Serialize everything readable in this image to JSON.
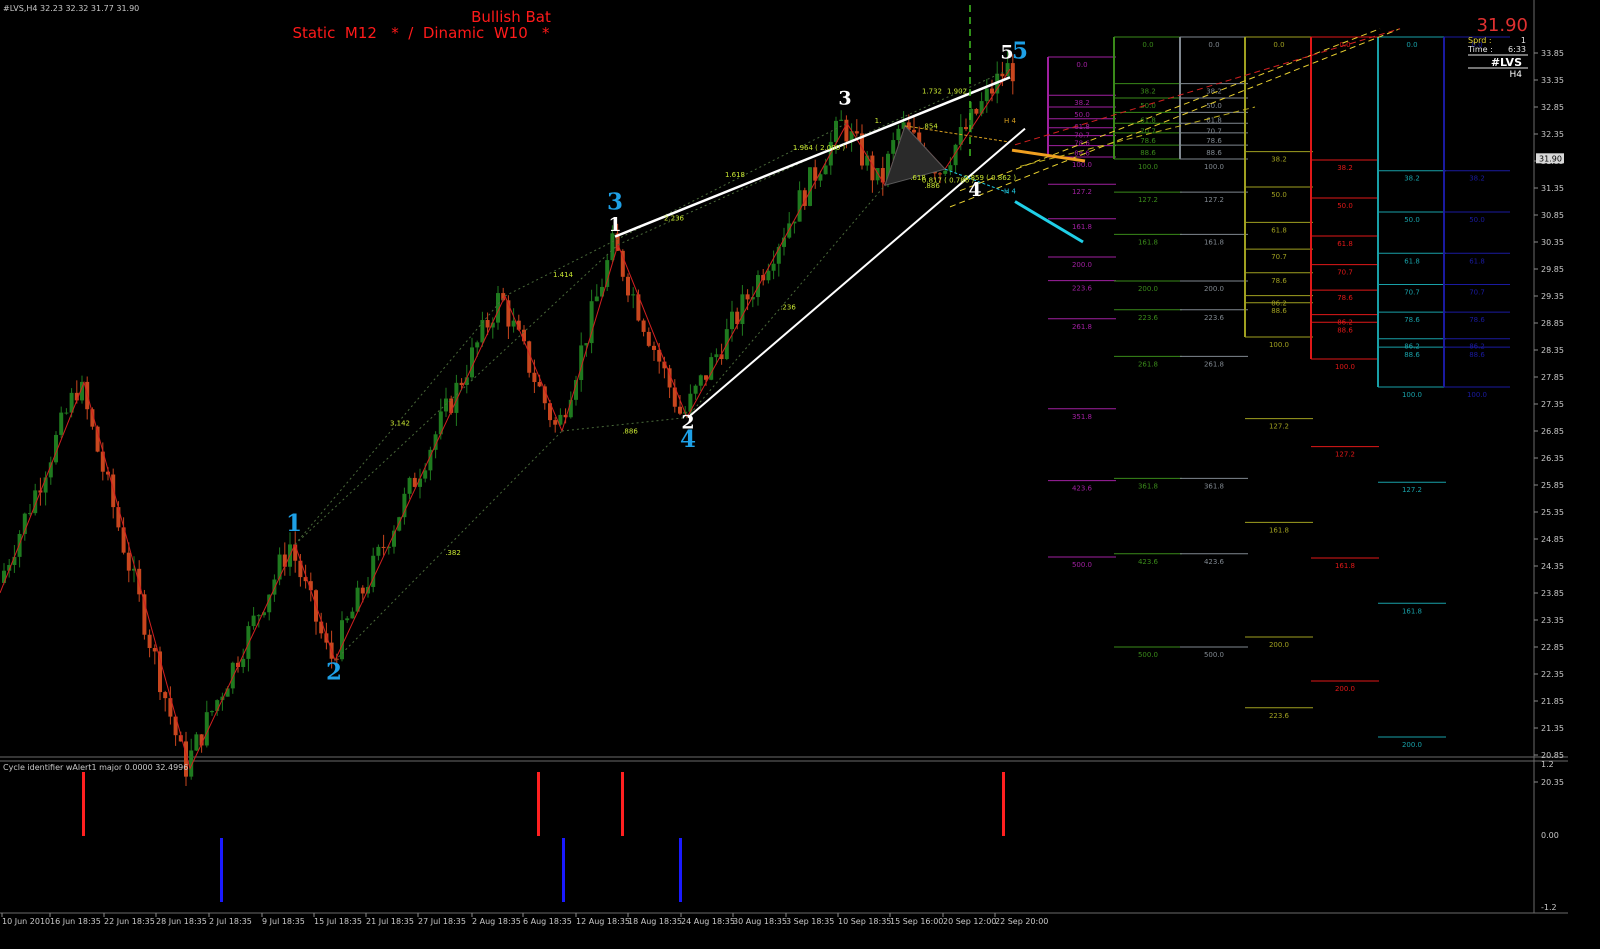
{
  "header": {
    "symbol_info": "#LVS,H4  32.23 32.32 31.77 31.90",
    "pattern_title": "Bullish Bat",
    "pattern_subtitle": "Static  M12   *  /  Dinamic  W10   *"
  },
  "info_panel": {
    "price": "31.90",
    "spread_label": "Sprd :",
    "spread_value": "1",
    "time_label": "Time :",
    "time_value": "6:33",
    "symbol": "#LVS",
    "timeframe": "H4"
  },
  "indicator": {
    "label": "Cycle identifier wAlert1 major 0.0000 32.4996",
    "scale": [
      "1.2",
      "0.00",
      "-1.2"
    ]
  },
  "colors": {
    "background": "#000000",
    "bull_candle": "#1f7a1f",
    "bear_candle": "#c8461e",
    "zigzag": "#d22020",
    "wave_white": "#ffffff",
    "wave_blue": "#1ea0e6",
    "title_red": "#ff1a1a",
    "fib_green": "#c8e632",
    "cycle_red": "#ff2020",
    "cycle_blue": "#1a1aff"
  },
  "chart_data": {
    "type": "candlestick",
    "symbol": "#LVS",
    "timeframe": "H4",
    "price_axis_ticks": [
      33.85,
      33.35,
      32.85,
      32.35,
      31.85,
      31.35,
      30.85,
      30.35,
      29.85,
      29.35,
      28.85,
      28.35,
      27.85,
      27.35,
      26.85,
      26.35,
      25.85,
      25.35,
      24.85,
      24.35,
      23.85,
      23.35,
      22.85,
      22.35,
      21.85,
      21.35,
      20.85,
      20.35
    ],
    "price_axis_labels": [
      "33.85",
      "33.35",
      "32.85",
      "32.35",
      "31.85",
      "31.35",
      "30.85",
      "30.35",
      "29.85",
      "29.35",
      "28.85",
      "28.35",
      "27.85",
      "27.35",
      "26.85",
      "26.35",
      "25.85",
      "25.35",
      "24.85",
      "24.35",
      "23.85",
      "23.35",
      "22.85",
      "22.35",
      "21.85",
      "21.35",
      "20.85",
      "20.35"
    ],
    "ylim": [
      20.22,
      34.2
    ],
    "current_price": 31.9,
    "current_price_label": "31.90",
    "date_labels": [
      "10 Jun 2010",
      "16 Jun 18:35",
      "22 Jun 18:35",
      "28 Jun 18:35",
      "2 Jul 18:35",
      "9 Jul 18:35",
      "15 Jul 18:35",
      "21 Jul 18:35",
      "27 Jul 18:35",
      "2 Aug 18:35",
      "6 Aug 18:35",
      "12 Aug 18:35",
      "18 Aug 18:35",
      "24 Aug 18:35",
      "30 Aug 18:35",
      "3 Sep 18:35",
      "10 Sep 18:35",
      "15 Sep 16:00",
      "20 Sep 12:00",
      "22 Sep 20:00"
    ],
    "zigzag_points": [
      [
        0,
        23.85
      ],
      [
        84,
        27.75
      ],
      [
        190,
        20.6
      ],
      [
        295,
        24.75
      ],
      [
        335,
        22.6
      ],
      [
        505,
        29.35
      ],
      [
        562,
        26.85
      ],
      [
        618,
        30.3
      ],
      [
        687,
        27.1
      ],
      [
        847,
        32.55
      ],
      [
        885,
        31.4
      ],
      [
        905,
        32.5
      ],
      [
        945,
        31.7
      ],
      [
        1010,
        33.55
      ]
    ],
    "wave_labels_white": [
      {
        "label": "1",
        "bar": 615,
        "price": 30.55
      },
      {
        "label": "2",
        "bar": 688,
        "price": 26.9
      },
      {
        "label": "3",
        "bar": 845,
        "price": 32.9
      },
      {
        "label": "4",
        "bar": 975,
        "price": 31.2
      },
      {
        "label": "5",
        "bar": 1007,
        "price": 33.75
      }
    ],
    "wave_labels_blue": [
      {
        "label": "1",
        "bar": 294,
        "price": 25.0
      },
      {
        "label": "2",
        "bar": 334,
        "price": 22.25
      },
      {
        "label": "3",
        "bar": 615,
        "price": 30.95
      },
      {
        "label": "4",
        "bar": 688,
        "price": 26.55
      },
      {
        "label": "5",
        "bar": 1020,
        "price": 33.75
      }
    ],
    "fib_ratio_labels": [
      {
        "text": "3.142",
        "bar": 400,
        "price": 26.95
      },
      {
        "text": ".382",
        "bar": 453,
        "price": 24.55
      },
      {
        "text": "1.414",
        "bar": 563,
        "price": 29.7
      },
      {
        "text": ".886",
        "bar": 630,
        "price": 26.8
      },
      {
        "text": "2.236",
        "bar": 674,
        "price": 30.75
      },
      {
        "text": "1.618",
        "bar": 735,
        "price": 31.55
      },
      {
        "text": ".236",
        "bar": 788,
        "price": 29.1
      },
      {
        "text": "1.964 ( 2.000 )",
        "bar": 819,
        "price": 32.05
      },
      {
        "text": "1.732",
        "bar": 932,
        "price": 33.1
      },
      {
        "text": "1.902",
        "bar": 957,
        "price": 33.1
      },
      {
        "text": ".618",
        "bar": 918,
        "price": 31.5
      },
      {
        "text": "0.817 ( 0.786 )",
        "bar": 948,
        "price": 31.45
      },
      {
        "text": ".886",
        "bar": 932,
        "price": 31.35
      },
      {
        "text": "0.859 ( 0.862 )",
        "bar": 990,
        "price": 31.5
      },
      {
        "text": ".854",
        "bar": 930,
        "price": 32.45
      },
      {
        "text": "1.",
        "bar": 878,
        "price": 32.55
      },
      {
        "text": "H 4",
        "bar": 1010,
        "price": 32.55
      },
      {
        "text": "H 4",
        "bar": 1010,
        "price": 31.25
      }
    ],
    "fib_ladders": [
      {
        "color": "#a020a0",
        "levels": [
          "0.0",
          "38.2",
          "50.0",
          "61.8",
          "70.7",
          "78.6",
          "88.6",
          "100.0",
          "127.2",
          "161.8",
          "200.0",
          "223.6",
          "261.8",
          "351.8",
          "423.6",
          "500.0"
        ]
      },
      {
        "color": "#3a8a1a",
        "levels": [
          "0.0",
          "38.2",
          "50.0",
          "61.8",
          "70.7",
          "78.6",
          "88.6",
          "100.0",
          "127.2",
          "161.8",
          "200.0",
          "223.6",
          "261.8",
          "361.8",
          "423.6",
          "500.0"
        ]
      },
      {
        "color": "#808890",
        "levels": [
          "0.0",
          "38.2",
          "50.0",
          "61.8",
          "70.7",
          "78.6",
          "88.6",
          "100.0",
          "127.2",
          "161.8",
          "200.0",
          "223.6",
          "261.8",
          "361.8",
          "423.6",
          "500.0"
        ]
      },
      {
        "color": "#a0a020",
        "levels": [
          "0.0",
          "38.2",
          "50.0",
          "61.8",
          "70.7",
          "78.6",
          "86.2",
          "88.6",
          "100.0",
          "127.2",
          "161.8",
          "200.0",
          "223.6"
        ]
      },
      {
        "color": "#e01818",
        "levels": [
          "0.0",
          "38.2",
          "50.0",
          "61.8",
          "70.7",
          "78.6",
          "86.2",
          "88.6",
          "100.0",
          "127.2",
          "161.8",
          "200.0"
        ]
      },
      {
        "color": "#18a0a8",
        "levels": [
          "0.0",
          "38.2",
          "50.0",
          "61.8",
          "70.7",
          "78.6",
          "86.2",
          "88.6",
          "100.0",
          "127.2",
          "161.8",
          "200.0"
        ]
      },
      {
        "color": "#1a1aa0",
        "levels": [
          "0.0",
          "38.2",
          "50.0",
          "61.8",
          "70.7",
          "78.6",
          "86.2",
          "88.6",
          "100.0"
        ]
      }
    ],
    "cycle_markers": [
      {
        "type": "top",
        "bar": 84
      },
      {
        "type": "bottom",
        "bar": 222
      },
      {
        "type": "top",
        "bar": 539
      },
      {
        "type": "bottom",
        "bar": 564
      },
      {
        "type": "top",
        "bar": 623
      },
      {
        "type": "bottom",
        "bar": 681
      },
      {
        "type": "top",
        "bar": 1004
      }
    ]
  }
}
